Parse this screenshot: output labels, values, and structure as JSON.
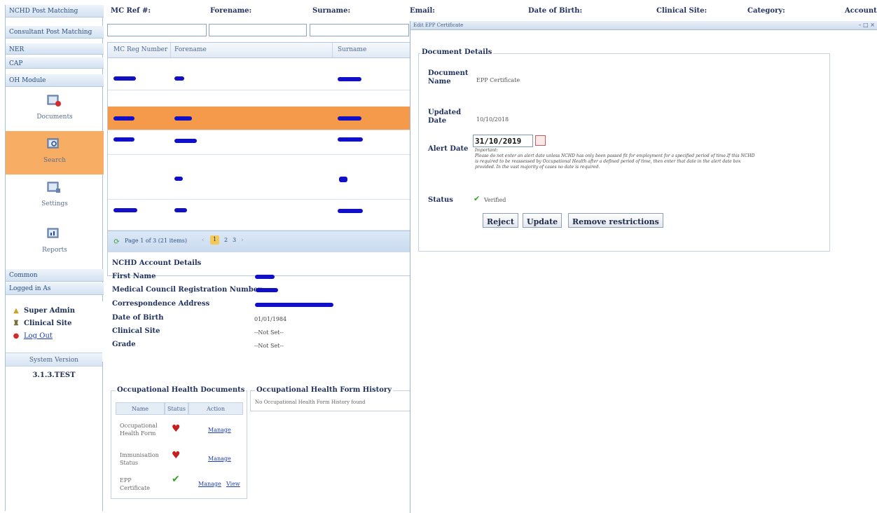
{
  "sidebar": {
    "sections": [
      {
        "label": "NCHD Post Matching"
      },
      {
        "label": "Consultant Post Matching"
      },
      {
        "label": "NER"
      },
      {
        "label": "CAP"
      },
      {
        "label": "OH Module"
      }
    ],
    "modules": [
      {
        "label": "Documents",
        "icon": "documents-icon"
      },
      {
        "label": "Search",
        "icon": "search-icon"
      },
      {
        "label": "Settings",
        "icon": "settings-icon"
      },
      {
        "label": "Reports",
        "icon": "reports-icon"
      }
    ],
    "bottom_sections": [
      {
        "label": "Common"
      },
      {
        "label": "Logged in As"
      }
    ],
    "logged_in": {
      "role": "Super Admin",
      "site": "Clinical Site",
      "logout": "Log Out"
    },
    "system_version_label": "System Version",
    "system_version": "3.1.3.TEST"
  },
  "search": {
    "mc_ref_label": "MC Ref #:",
    "forename_label": "Forename:",
    "surname_label": "Surname:",
    "email_label": "Email:",
    "dob_label": "Date of Birth:",
    "clinical_site_label": "Clinical Site:",
    "category_label": "Category:",
    "account_label": "Account"
  },
  "grid": {
    "columns": [
      "MC Reg Number",
      "Forename",
      "Surname"
    ],
    "rows": 6,
    "selected_row": 2
  },
  "pager": {
    "summary": "Page 1 of 3 (21 items)",
    "pages": [
      "1",
      "2",
      "3"
    ],
    "current_page": "1"
  },
  "account": {
    "title": "NCHD Account Details",
    "first_name_label": "First Name",
    "mcrn_label": "Medical Council Registration Number",
    "address_label": "Correspondence Address",
    "dob_label": "Date of Birth",
    "dob_value": "01/01/1984",
    "site_label": "Clinical Site",
    "site_value": "--Not Set--",
    "grade_label": "Grade",
    "grade_value": "--Not Set--"
  },
  "oh_docs": {
    "title": "Occupational Health Documents",
    "columns": [
      "Name",
      "Status",
      "Action"
    ],
    "rows": [
      {
        "name": "Occupational Health Form",
        "status": "thumbs-down-icon",
        "action": "Manage",
        "view": ""
      },
      {
        "name": "Immunisation Status",
        "status": "thumbs-down-icon",
        "action": "Manage",
        "view": ""
      },
      {
        "name": "EPP Certificate",
        "status": "check-icon",
        "action": "Manage",
        "view": "View"
      }
    ]
  },
  "oh_history": {
    "title": "Occupational Health Form History",
    "empty": "No Occupational Health Form History found"
  },
  "modal": {
    "title": "Edit EPP Certificate",
    "controls": "– □ ×",
    "section_title": "Document Details",
    "document_name_label": "Document Name",
    "document_name": "EPP Certificate",
    "updated_label": "Updated Date",
    "updated_value": "10/10/2018",
    "alert_label": "Alert Date",
    "alert_value": "31/10/2019",
    "important": "Important:",
    "notice": "Please do not enter an alert date unless NCHD has only been passed fit for employment for a specified period of time.If this NCHD is required to be reassessed by Occupational Health after a defined period of time, then enter that date in the alert date box provided. In the vast majority of cases no date is required.",
    "status_label": "Status",
    "status_value": "Verified",
    "buttons": {
      "reject": "Reject",
      "update": "Update",
      "remove": "Remove restrictions"
    }
  },
  "colors": {
    "selected_row": "#f59a4a",
    "selected_module": "#f7ad63",
    "redaction": "#1010c8",
    "accent": "#2a4d80"
  }
}
